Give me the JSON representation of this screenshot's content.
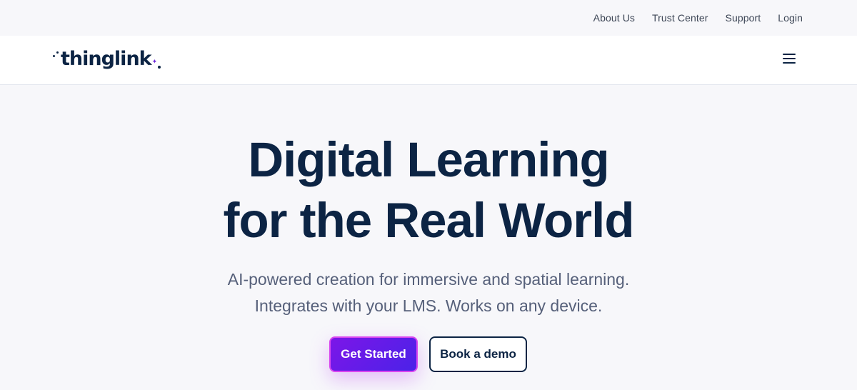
{
  "topbar": {
    "links": [
      "About Us",
      "Trust Center",
      "Support",
      "Login"
    ]
  },
  "nav": {
    "logo_text": "thinglink",
    "menu_icon": "hamburger-menu-icon"
  },
  "hero": {
    "title_line1": "Digital Learning",
    "title_line2": "for the Real World",
    "subtitle_line1": "AI-powered creation for immersive and spatial learning.",
    "subtitle_line2": "Integrates with your LMS. Works on any device."
  },
  "cta": {
    "primary_label": "Get Started",
    "secondary_label": "Book a demo"
  },
  "colors": {
    "navy": "#0c2444",
    "accent_purple": "#7c16e8",
    "accent_border": "#d946ef",
    "background": "#f7f7fa"
  }
}
